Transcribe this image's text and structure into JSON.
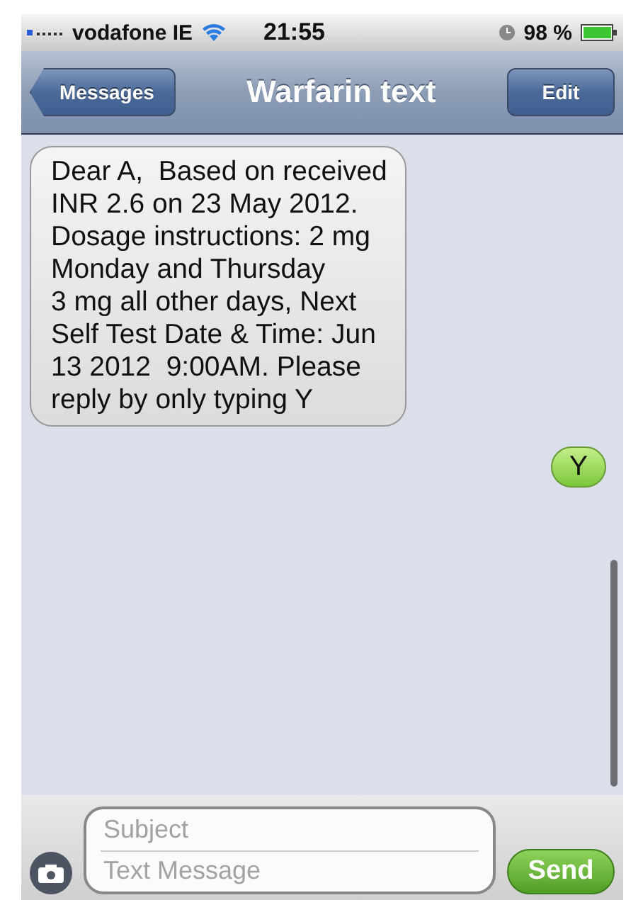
{
  "status_bar": {
    "carrier": "vodafone IE",
    "time": "21:55",
    "battery": "98 %"
  },
  "nav": {
    "back": "Messages",
    "title": "Warfarin text",
    "edit": "Edit"
  },
  "messages": [
    {
      "kind": "received",
      "text": "Dear A,  Based on received INR 2.6 on 23 May 2012. Dosage instructions: 2 mg Monday and Thursday\n3 mg all other days, Next Self Test Date & Time: Jun 13 2012  9:00AM. Please reply by only typing Y"
    },
    {
      "kind": "sent",
      "text": "Y"
    }
  ],
  "composer": {
    "subject_placeholder": "Subject",
    "message_placeholder": "Text Message",
    "send": "Send"
  }
}
